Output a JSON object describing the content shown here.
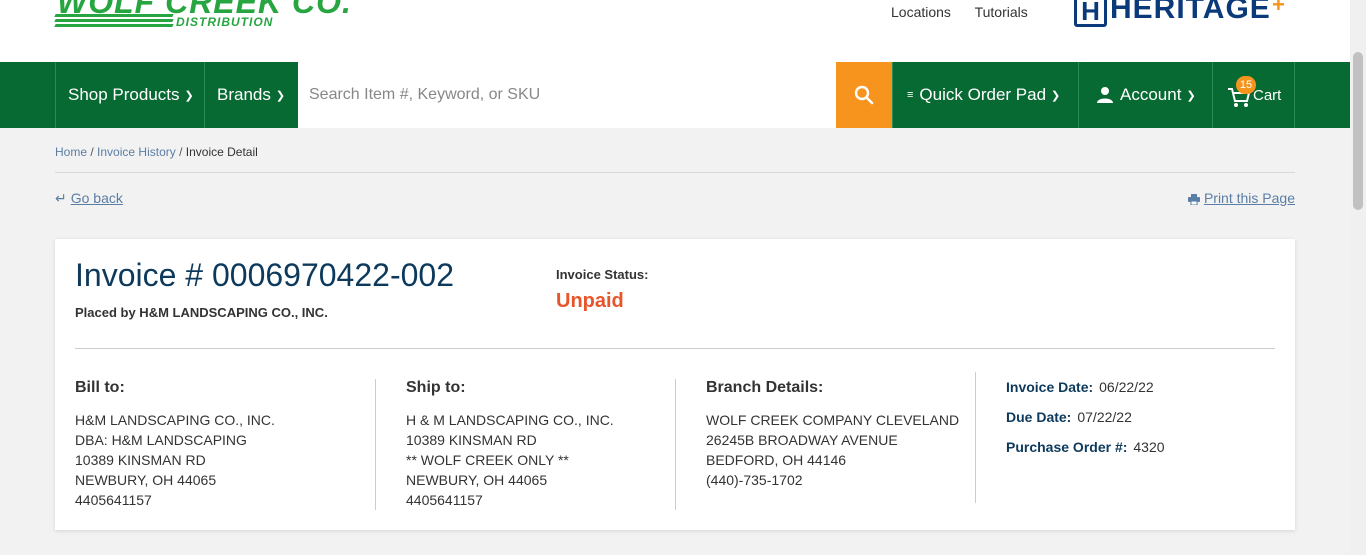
{
  "header": {
    "logo_text": "WOLF CREEK CO.",
    "logo_subtext": "DISTRIBUTION",
    "links": [
      "Locations",
      "Tutorials"
    ],
    "partner_logo_text": "HERITAGE"
  },
  "nav": {
    "shop_products": "Shop Products",
    "brands": "Brands",
    "search_placeholder": "Search Item #, Keyword, or SKU",
    "quick_order_pad": "Quick Order Pad",
    "account": "Account",
    "cart": "Cart",
    "cart_count": "15"
  },
  "breadcrumb": {
    "home": "Home",
    "sep": "/",
    "invoice_history": "Invoice History",
    "current": "Invoice Detail"
  },
  "actions": {
    "go_back": "Go back",
    "print": "Print this Page"
  },
  "invoice": {
    "title": "Invoice # 0006970422-002",
    "placed_by": "Placed by H&M LANDSCAPING CO., INC.",
    "status_label": "Invoice Status:",
    "status": "Unpaid",
    "bill_to": {
      "heading": "Bill to:",
      "lines": [
        "H&M LANDSCAPING CO., INC.",
        "DBA: H&M LANDSCAPING",
        "10389 KINSMAN RD",
        "NEWBURY, OH 44065",
        "4405641157"
      ]
    },
    "ship_to": {
      "heading": "Ship to:",
      "lines": [
        "H & M LANDSCAPING CO., INC.",
        "10389 KINSMAN RD",
        "** WOLF CREEK ONLY **",
        "NEWBURY, OH 44065",
        "4405641157"
      ]
    },
    "branch": {
      "heading": "Branch Details:",
      "lines": [
        "WOLF CREEK COMPANY CLEVELAND",
        "26245B BROADWAY AVENUE",
        "BEDFORD, OH 44146",
        "(440)-735-1702"
      ]
    },
    "meta": [
      {
        "label": "Invoice Date:",
        "value": "06/22/22"
      },
      {
        "label": "Due Date:",
        "value": "07/22/22"
      },
      {
        "label": "Purchase Order #:",
        "value": "4320"
      }
    ]
  },
  "colors": {
    "brand_green": "#086a33",
    "accent_orange": "#f7941d",
    "status_red": "#e8552a",
    "title_navy": "#0d3a5c"
  }
}
